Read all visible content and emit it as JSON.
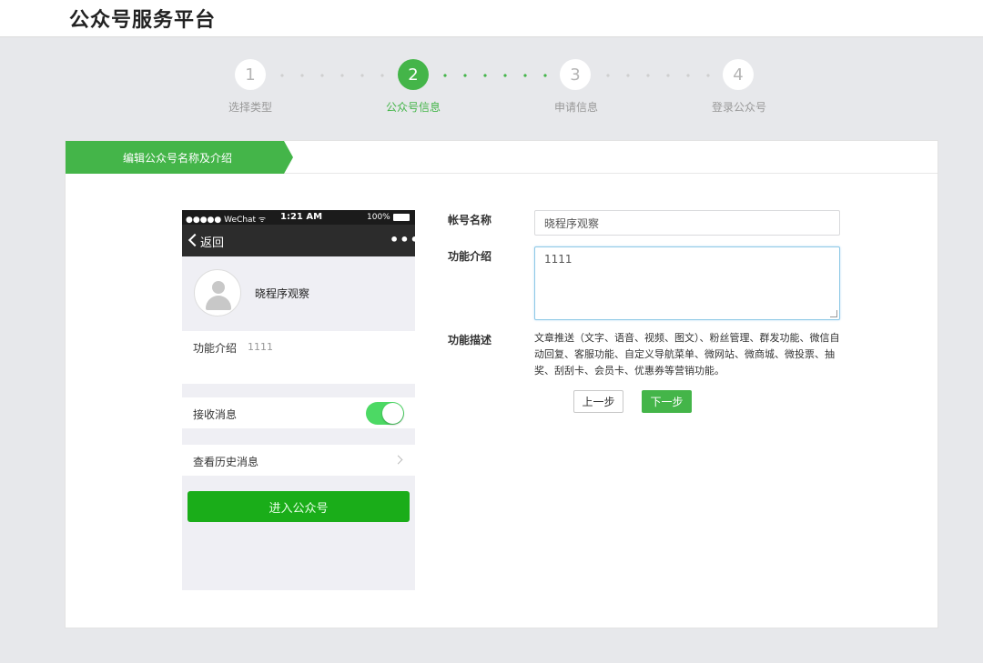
{
  "header": {
    "brand": "公众号服务平台"
  },
  "stepper": {
    "steps": [
      {
        "number": "1",
        "label": "选择类型",
        "state": "done"
      },
      {
        "number": "2",
        "label": "公众号信息",
        "state": "active"
      },
      {
        "number": "3",
        "label": "申请信息",
        "state": "pending"
      },
      {
        "number": "4",
        "label": "登录公众号",
        "state": "pending"
      }
    ]
  },
  "panel": {
    "section_title": "编辑公众号名称及介绍"
  },
  "preview": {
    "status": {
      "carrier": "●●●●● WeChat ᯤ",
      "time": "1:21 AM",
      "battery": "100%"
    },
    "nav": {
      "back_label": "返回",
      "more": "•••"
    },
    "profile_name": "晓程序观察",
    "intro_label": "功能介绍",
    "intro_value": "1111",
    "receive_label": "接收消息",
    "receive_on": true,
    "history_label": "查看历史消息",
    "enter_button": "进入公众号"
  },
  "form": {
    "account_name_label": "帐号名称",
    "account_name_value": "晓程序观察",
    "intro_label": "功能介绍",
    "intro_value": "1111",
    "description_label": "功能描述",
    "description_text": "文章推送（文字、语音、视频、图文）、粉丝管理、群发功能、微信自动回复、客服功能、自定义导航菜单、微网站、微商城、微投票、抽奖、刮刮卡、会员卡、优惠券等营销功能。",
    "prev_button": "上一步",
    "next_button": "下一步"
  },
  "colors": {
    "accent": "#44b549",
    "background": "#e7e8eb",
    "toggle_on": "#4cd964",
    "enter_button": "#1aad19"
  }
}
